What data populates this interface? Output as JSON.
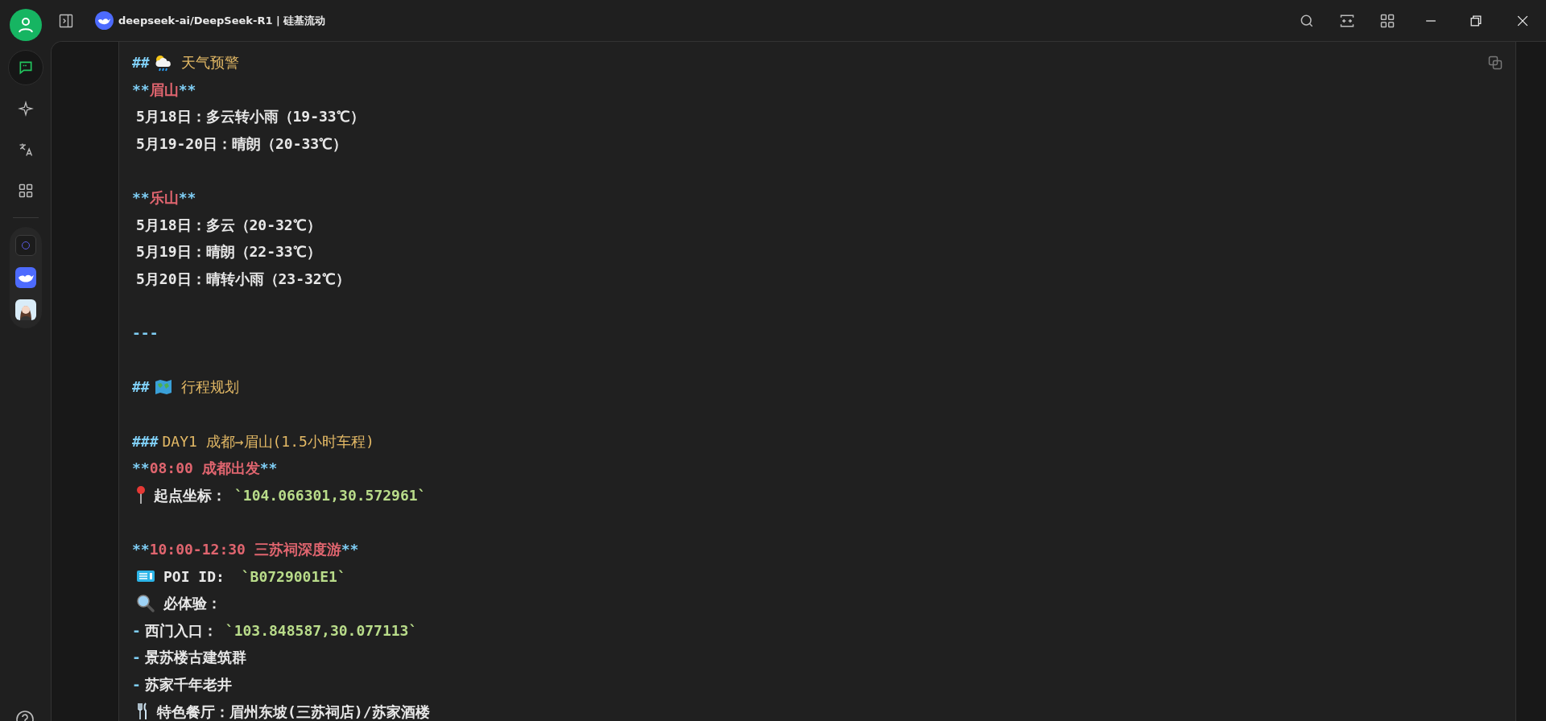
{
  "title_bar": {
    "title": "deepseek-ai/DeepSeek-R1 | 硅基流动"
  },
  "sidebar": {
    "items": [
      {
        "kind": "chat",
        "selected": true
      },
      {
        "kind": "sparkle",
        "selected": false
      },
      {
        "kind": "translate",
        "selected": false
      },
      {
        "kind": "apps",
        "selected": false
      }
    ]
  },
  "message": {
    "lines": [
      {
        "kind": "text",
        "segments": [
          {
            "kind": "marker",
            "text": "##"
          },
          {
            "kind": "icon"
          },
          {
            "kind": "heading",
            "text": "天气预警"
          }
        ]
      },
      {
        "kind": "text",
        "segments": [
          {
            "kind": "marker",
            "text": "**"
          },
          {
            "kind": "bold",
            "text": "眉山"
          },
          {
            "kind": "marker",
            "text": "**"
          }
        ]
      },
      {
        "kind": "text",
        "segments": [
          {
            "kind": "plain",
            "text": "5月18日：多云转小雨（19-33℃）"
          }
        ]
      },
      {
        "kind": "text",
        "segments": [
          {
            "kind": "plain",
            "text": "5月19-20日：晴朗（20-33℃）"
          }
        ]
      },
      {
        "kind": "blank"
      },
      {
        "kind": "text",
        "segments": [
          {
            "kind": "marker",
            "text": "**"
          },
          {
            "kind": "bold",
            "text": "乐山"
          },
          {
            "kind": "marker",
            "text": "**"
          }
        ]
      },
      {
        "kind": "text",
        "segments": [
          {
            "kind": "plain",
            "text": "5月18日：多云（20-32℃）"
          }
        ]
      },
      {
        "kind": "text",
        "segments": [
          {
            "kind": "plain",
            "text": "5月19日：晴朗（22-33℃）"
          }
        ]
      },
      {
        "kind": "text",
        "segments": [
          {
            "kind": "plain",
            "text": "5月20日：晴转小雨（23-32℃）"
          }
        ]
      },
      {
        "kind": "blank"
      },
      {
        "kind": "text",
        "segments": [
          {
            "kind": "marker",
            "text": "---"
          }
        ]
      },
      {
        "kind": "blank"
      },
      {
        "kind": "text",
        "segments": [
          {
            "kind": "marker",
            "text": "##"
          },
          {
            "kind": "icon"
          },
          {
            "kind": "heading",
            "text": "行程规划"
          }
        ]
      },
      {
        "kind": "blank"
      },
      {
        "kind": "text",
        "segments": [
          {
            "kind": "marker",
            "text": "###"
          },
          {
            "kind": "heading",
            "text": "DAY1 成都→眉山(1.5小时车程)"
          }
        ]
      },
      {
        "kind": "text",
        "segments": [
          {
            "kind": "marker",
            "text": "**"
          },
          {
            "kind": "bold",
            "text": "08:00 成都出发"
          },
          {
            "kind": "marker",
            "text": "**"
          }
        ]
      },
      {
        "kind": "text",
        "segments": [
          {
            "kind": "icon"
          },
          {
            "kind": "plain",
            "text": "起点坐标："
          },
          {
            "kind": "code",
            "text": "`104.066301,30.572961`"
          }
        ]
      },
      {
        "kind": "blank"
      },
      {
        "kind": "text",
        "segments": [
          {
            "kind": "marker",
            "text": "**"
          },
          {
            "kind": "bold",
            "text": "10:00-12:30 三苏祠深度游"
          },
          {
            "kind": "marker",
            "text": "**"
          }
        ]
      },
      {
        "kind": "text",
        "segments": [
          {
            "kind": "icon"
          },
          {
            "kind": "plain",
            "text": "POI ID: "
          },
          {
            "kind": "code",
            "text": "`B0729001E1`"
          }
        ]
      },
      {
        "kind": "text",
        "segments": [
          {
            "kind": "icon"
          },
          {
            "kind": "plain",
            "text": "必体验："
          }
        ]
      },
      {
        "kind": "text",
        "segments": [
          {
            "kind": "marker",
            "text": "-"
          },
          {
            "kind": "plain",
            "text": "西门入口："
          },
          {
            "kind": "code",
            "text": "`103.848587,30.077113`"
          }
        ]
      },
      {
        "kind": "text",
        "segments": [
          {
            "kind": "marker",
            "text": "-"
          },
          {
            "kind": "plain",
            "text": "景苏楼古建筑群"
          }
        ]
      },
      {
        "kind": "text",
        "segments": [
          {
            "kind": "marker",
            "text": "-"
          },
          {
            "kind": "plain",
            "text": "苏家千年老井"
          }
        ]
      },
      {
        "kind": "text",
        "segments": [
          {
            "kind": "icon"
          },
          {
            "kind": "plain",
            "text": "特色餐厅：眉州东坡(三苏祠店)/苏家酒楼"
          }
        ]
      }
    ]
  }
}
